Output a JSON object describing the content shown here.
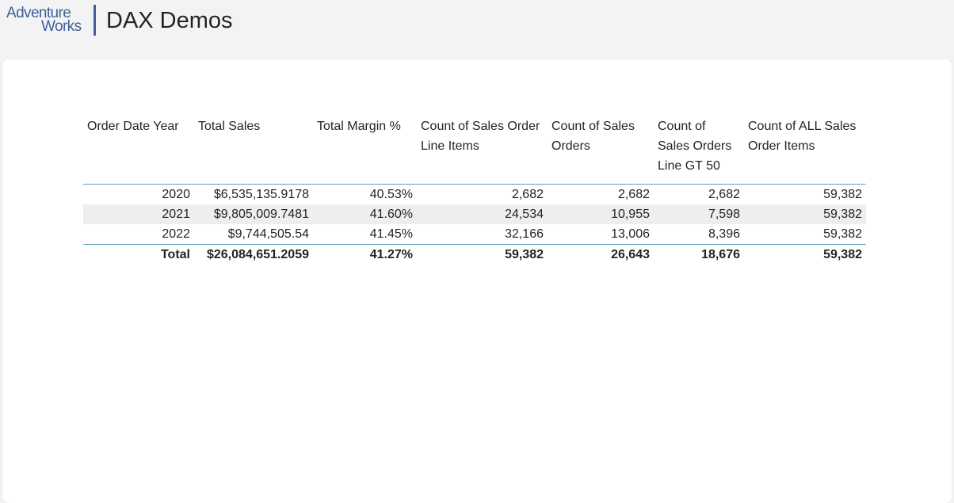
{
  "header": {
    "logo_line1": "Adventure",
    "logo_line2": "Works",
    "title": "DAX Demos"
  },
  "colors": {
    "brand_blue": "#3f5f9c",
    "table_rule": "#5da3b8",
    "banded_row": "#eeeeee",
    "page_background": "#f3f3f3"
  },
  "table": {
    "columns": [
      "Order Date Year",
      "Total Sales",
      "Total Margin %",
      "Count of Sales Order Line Items",
      "Count of Sales Orders",
      "Count of Sales Orders Line GT 50",
      "Count of ALL Sales Order Items"
    ],
    "rows": [
      [
        "2020",
        "$6,535,135.9178",
        "40.53%",
        "2,682",
        "2,682",
        "2,682",
        "59,382"
      ],
      [
        "2021",
        "$9,805,009.7481",
        "41.60%",
        "24,534",
        "10,955",
        "7,598",
        "59,382"
      ],
      [
        "2022",
        "$9,744,505.54",
        "41.45%",
        "32,166",
        "13,006",
        "8,396",
        "59,382"
      ]
    ],
    "total": [
      "Total",
      "$26,084,651.2059",
      "41.27%",
      "59,382",
      "26,643",
      "18,676",
      "59,382"
    ]
  }
}
